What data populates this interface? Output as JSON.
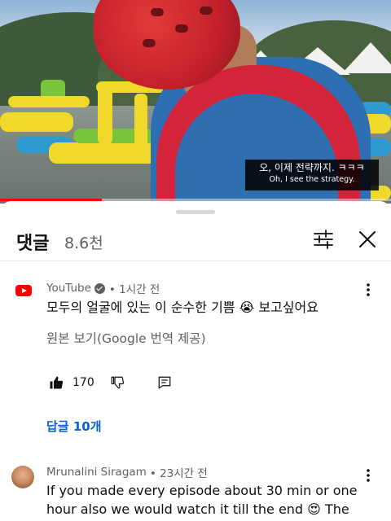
{
  "video": {
    "subtitle_ko": "오, 이제 전략까지. ㅋㅋㅋ",
    "subtitle_en": "Oh, I see the strategy.",
    "progress": 0.26
  },
  "comments_panel": {
    "title": "댓글",
    "count": "8.6천"
  },
  "comments": [
    {
      "author": "YouTube",
      "time": "• 1시간 전",
      "text": "모두의 얼굴에 있는 이 순수한 기쁨 😭 보고싶어요",
      "translate_label": "원본 보기(Google 번역 제공)",
      "likes": "170",
      "replies_label": "답글 10개"
    },
    {
      "author": "Mrunalini Siragam",
      "time": "• 23시간 전",
      "text_line1": "If you made every episode about 30 min or one",
      "text_line2": "hour also we would watch it till the end 😍 The"
    }
  ],
  "colors": {
    "accent_red": "#ff0000",
    "link_blue": "#065fd4",
    "secondary_text": "#606060"
  },
  "icons": {
    "filter": "sliders-icon",
    "close": "close-icon",
    "like": "thumbs-up-icon",
    "dislike": "thumbs-down-icon",
    "reply": "comment-icon",
    "more": "more-vert-icon"
  }
}
